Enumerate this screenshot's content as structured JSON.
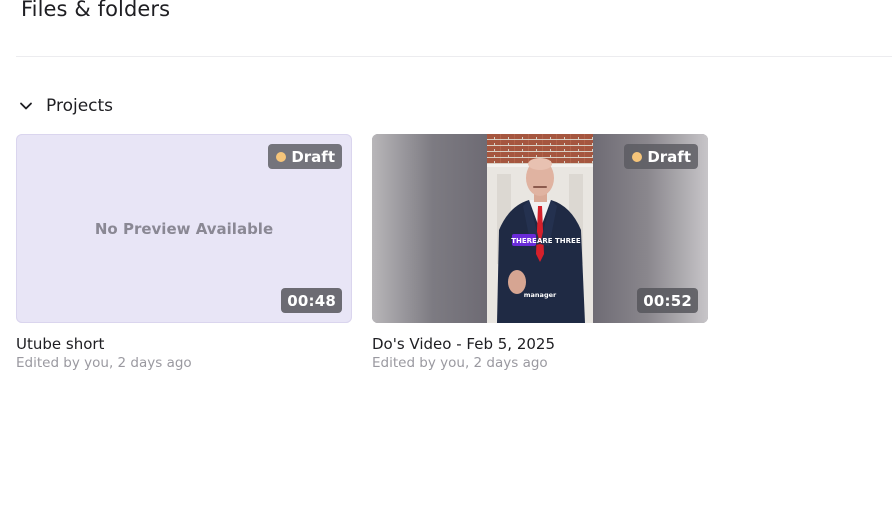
{
  "header": {
    "title": "Files & folders"
  },
  "section": {
    "title": "Projects",
    "icon": "chevron-down-icon"
  },
  "projects": [
    {
      "preview_text": "No Preview Available",
      "status": "Draft",
      "duration": "00:48",
      "title": "Utube short",
      "meta": "Edited by you, 2 days ago"
    },
    {
      "status": "Draft",
      "duration": "00:52",
      "caption_highlight": "THERE",
      "caption_rest": "ARE THREE",
      "subtitle": "manager",
      "title": "Do's Video - Feb 5, 2025",
      "meta": "Edited by you, 2 days ago"
    }
  ],
  "colors": {
    "empty_thumb": "#e8e5f6",
    "draft_dot": "#f6c57a",
    "caption_highlight": "#6a2bd8",
    "tie": "#d5202b"
  }
}
